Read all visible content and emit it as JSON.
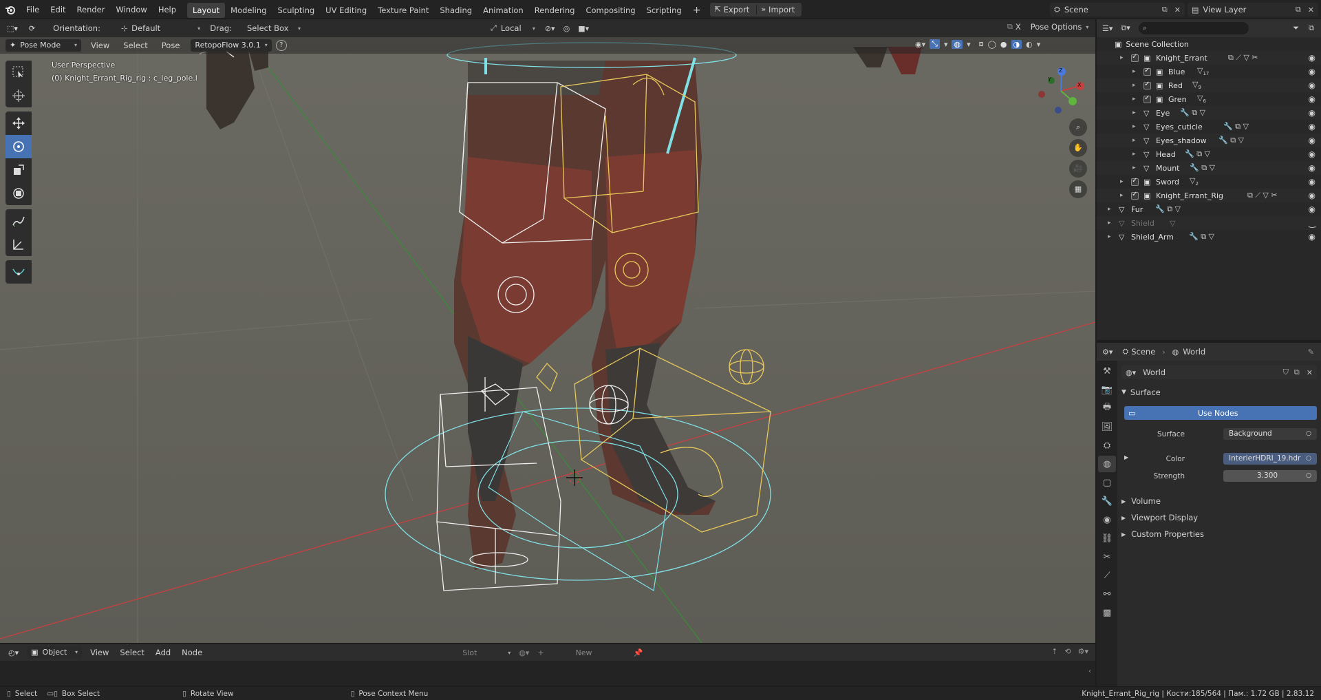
{
  "topbar": {
    "menus": [
      "File",
      "Edit",
      "Render",
      "Window",
      "Help"
    ],
    "workspaces": [
      "Layout",
      "Modeling",
      "Sculpting",
      "UV Editing",
      "Texture Paint",
      "Shading",
      "Animation",
      "Rendering",
      "Compositing",
      "Scripting"
    ],
    "active_workspace": "Layout",
    "add_tab": "+",
    "export_label": "Export",
    "import_label": "Import",
    "scene": "Scene",
    "view_layer": "View Layer"
  },
  "viewport_header": {
    "orientation_label": "Orientation:",
    "orientation_value": "Default",
    "drag_label": "Drag:",
    "drag_value": "Select Box",
    "pivot_value": "Local",
    "axis_x": "X",
    "pose_options": "Pose Options",
    "mode": "Pose Mode",
    "menus": [
      "View",
      "Select",
      "Pose"
    ],
    "addon": "RetopoFlow 3.0.1",
    "help": "?"
  },
  "viewport_overlay": {
    "perspective": "User Perspective",
    "active_info": "(0) Knight_Errant_Rig_rig : c_leg_pole.l"
  },
  "gizmo": {
    "x": "X",
    "y": "Y",
    "z": "Z"
  },
  "outliner": {
    "root": "Scene Collection",
    "rows": [
      {
        "name": "Knight_Errant",
        "indent": 1,
        "kind": "collection",
        "badge": ""
      },
      {
        "name": "Blue",
        "indent": 2,
        "kind": "collection",
        "badge": "17"
      },
      {
        "name": "Red",
        "indent": 2,
        "kind": "collection",
        "badge": "9"
      },
      {
        "name": "Gren",
        "indent": 2,
        "kind": "collection",
        "badge": "6"
      },
      {
        "name": "Eye",
        "indent": 2,
        "kind": "mesh",
        "badge": ""
      },
      {
        "name": "Eyes_cuticle",
        "indent": 2,
        "kind": "mesh",
        "badge": ""
      },
      {
        "name": "Eyes_shadow",
        "indent": 2,
        "kind": "mesh",
        "badge": ""
      },
      {
        "name": "Head",
        "indent": 2,
        "kind": "mesh",
        "badge": ""
      },
      {
        "name": "Mount",
        "indent": 2,
        "kind": "mesh",
        "badge": ""
      },
      {
        "name": "Sword",
        "indent": 1,
        "kind": "collection",
        "badge": "2"
      },
      {
        "name": "Knight_Errant_Rig",
        "indent": 1,
        "kind": "collection",
        "badge": ""
      },
      {
        "name": "Fur",
        "indent": 0,
        "kind": "mesh",
        "badge": ""
      },
      {
        "name": "Shield",
        "indent": 0,
        "kind": "mesh-hidden",
        "badge": ""
      },
      {
        "name": "Shield_Arm",
        "indent": 0,
        "kind": "mesh",
        "badge": ""
      }
    ]
  },
  "properties": {
    "breadcrumb_scene": "Scene",
    "breadcrumb_world": "World",
    "world_name": "World",
    "surface_panel": "Surface",
    "use_nodes": "Use Nodes",
    "surface_label": "Surface",
    "surface_value": "Background",
    "color_label": "Color",
    "color_value": "InterierHDRI_19.hdr",
    "strength_label": "Strength",
    "strength_value": "3.300",
    "panels": [
      "Volume",
      "Viewport Display",
      "Custom Properties"
    ]
  },
  "bottom_header": {
    "mode": "Object",
    "menus": [
      "View",
      "Select",
      "Add",
      "Node"
    ],
    "slot": "Slot",
    "new": "New"
  },
  "statusbar": {
    "select": "Select",
    "box_select": "Box Select",
    "rotate_view": "Rotate View",
    "context_menu": "Pose Context Menu",
    "stats": "Knight_Errant_Rig_rig | Кости:185/564 | Пам.: 1.72 GB | 2.83.12"
  },
  "colors": {
    "accent": "#4772b3",
    "bone_selected": "#e8c85a",
    "bone_cyan": "#7fe0e6",
    "axis_red": "#c84040",
    "axis_green": "#3a8a3a"
  }
}
